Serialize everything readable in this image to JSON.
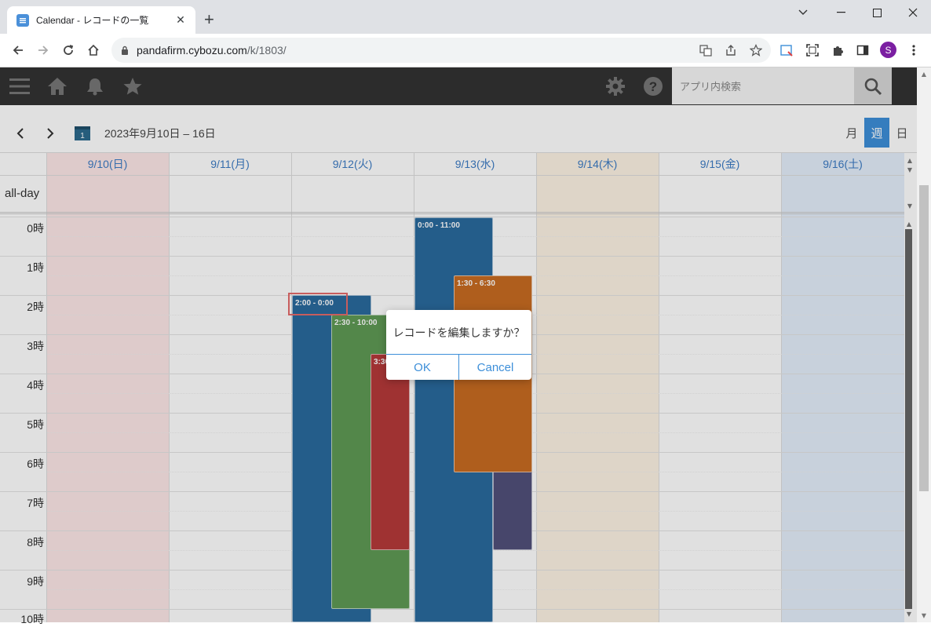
{
  "browser": {
    "tab_title": "Calendar - レコードの一覧",
    "url_host": "pandafirm.cybozu.com",
    "url_path": "/k/1803/",
    "profile_initial": "S"
  },
  "app_header": {
    "search_placeholder": "アプリ内検索"
  },
  "calendar": {
    "range": "2023年9月10日 – 16日",
    "views": [
      "月",
      "週",
      "日"
    ],
    "active_view": "週",
    "allday_label": "all-day",
    "days": [
      {
        "label": "9/10(日)",
        "tint": "#fde8e8"
      },
      {
        "label": "9/11(月)",
        "tint": "#ffffff"
      },
      {
        "label": "9/12(火)",
        "tint": "#ffffff"
      },
      {
        "label": "9/13(水)",
        "tint": "#ffffff"
      },
      {
        "label": "9/14(木)",
        "tint": "#fdf3e4"
      },
      {
        "label": "9/15(金)",
        "tint": "#ffffff"
      },
      {
        "label": "9/16(土)",
        "tint": "#e4eefb"
      }
    ],
    "hours": [
      "0時",
      "1時",
      "2時",
      "3時",
      "4時",
      "5時",
      "6時",
      "7時",
      "8時",
      "9時",
      "10時"
    ],
    "events": [
      {
        "label": "0:00 - 11:00",
        "color": "#2a6a9e"
      },
      {
        "label": "1:30 - 6:30",
        "color": "#c86b22"
      },
      {
        "label": "2:00 - 0:00",
        "color": "#2a6a9e"
      },
      {
        "label": "2:30 - 10:00",
        "color": "#5f9a55"
      },
      {
        "label": "3:30",
        "color": "#b53a3a"
      },
      {
        "label": "",
        "color": "#51507a"
      }
    ]
  },
  "dialog": {
    "message": "レコードを編集しますか？",
    "ok": "OK",
    "cancel": "Cancel"
  }
}
